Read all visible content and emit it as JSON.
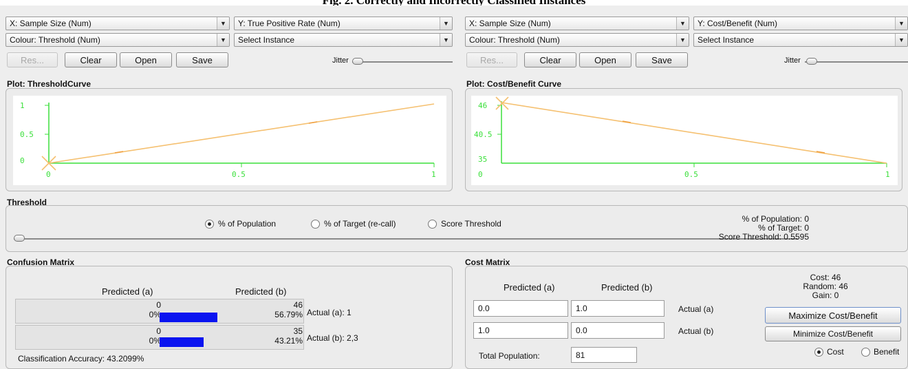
{
  "caption": "Fig. 2. Correctly and Incorrectly Classified Instances",
  "left": {
    "x_axis": "X: Sample Size (Num)",
    "y_axis": "Y: True Positive Rate (Num)",
    "colour": "Colour: Threshold (Num)",
    "select_instance": "Select Instance",
    "buttons": {
      "reset": "Res...",
      "clear": "Clear",
      "open": "Open",
      "save": "Save"
    },
    "jitter_label": "Jitter",
    "plot_title": "Plot: ThresholdCurve",
    "y_ticks": [
      "1",
      "0.5",
      "0"
    ],
    "x_ticks": [
      "0",
      "0.5",
      "1"
    ]
  },
  "right": {
    "x_axis": "X: Sample Size (Num)",
    "y_axis": "Y: Cost/Benefit (Num)",
    "colour": "Colour: Threshold (Num)",
    "select_instance": "Select Instance",
    "buttons": {
      "reset": "Res...",
      "clear": "Clear",
      "open": "Open",
      "save": "Save"
    },
    "jitter_label": "Jitter",
    "plot_title": "Plot: Cost/Benefit Curve",
    "y_ticks": [
      "46",
      "40.5",
      "35"
    ],
    "x_ticks": [
      "0",
      "0.5",
      "1"
    ]
  },
  "threshold": {
    "title": "Threshold",
    "options": [
      "% of Population",
      "% of Target (re-call)",
      "Score Threshold"
    ],
    "selected": 0,
    "stats": {
      "population": "% of Population: 0",
      "target": "% of Target: 0",
      "score": "Score Threshold: 0.5595"
    }
  },
  "confusion": {
    "title": "Confusion Matrix",
    "pred_a": "Predicted (a)",
    "pred_b": "Predicted (b)",
    "rows": [
      {
        "a_count": "0",
        "a_pct": "0%",
        "b_count": "46",
        "b_pct": "56.79%",
        "actual": "Actual (a): 1"
      },
      {
        "a_count": "0",
        "a_pct": "0%",
        "b_count": "35",
        "b_pct": "43.21%",
        "actual": "Actual (b): 2,3"
      }
    ],
    "accuracy": "Classification Accuracy:  43.2099%",
    "bar_color": "#0a14f0"
  },
  "cost": {
    "title": "Cost Matrix",
    "pred_a": "Predicted (a)",
    "pred_b": "Predicted (b)",
    "rows": [
      {
        "a": "0.0",
        "b": "1.0",
        "actual": "Actual (a)"
      },
      {
        "a": "1.0",
        "b": "0.0",
        "actual": "Actual (b)"
      }
    ],
    "total_label": "Total Population:",
    "total_value": "81",
    "summary": {
      "cost": "Cost: 46",
      "random": "Random: 46",
      "gain": "Gain: 0"
    },
    "maximize": "Maximize Cost/Benefit",
    "minimize": "Minimize Cost/Benefit",
    "mode_options": [
      "Cost",
      "Benefit"
    ],
    "mode_selected": 0
  },
  "colors": {
    "axis": "#3adf3a",
    "curve": "#f5c070",
    "tick_text": "#3adf3a"
  }
}
